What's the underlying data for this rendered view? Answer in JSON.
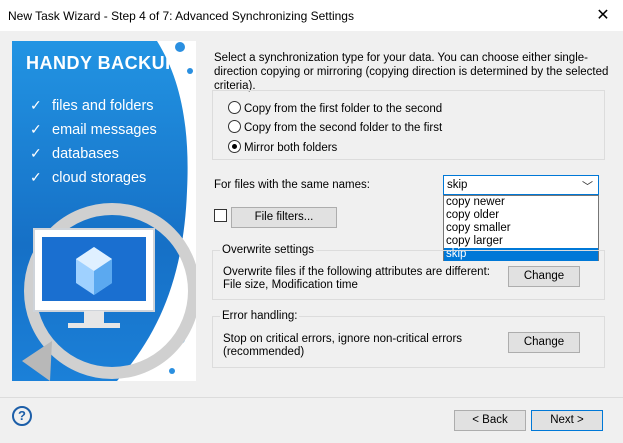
{
  "window": {
    "title": "New Task Wizard - Step 4 of 7: Advanced Synchronizing Settings",
    "close_glyph": "✕"
  },
  "banner": {
    "brand": "HANDY BACKUP",
    "check_glyph": "✓",
    "features": [
      "files and folders",
      "email messages",
      "databases",
      "cloud storages"
    ],
    "colors": {
      "primary": "#1f8fe0",
      "dark": "#1672c8",
      "screen": "#1a6fd0"
    }
  },
  "description": "Select a synchronization type for your data. You can choose either single-direction copying or mirroring (copying direction is determined by the selected criteria).",
  "sync_options": {
    "items": [
      {
        "label": "Copy from the first folder to the second",
        "selected": false
      },
      {
        "label": "Copy from the second folder to the first",
        "selected": false
      },
      {
        "label": "Mirror both folders",
        "selected": true
      }
    ]
  },
  "same_names": {
    "label": "For files with the same names:",
    "value": "skip",
    "options": [
      "copy newer",
      "copy older",
      "copy smaller",
      "copy larger",
      "skip"
    ]
  },
  "file_filters": {
    "button": "File filters...",
    "checked": false
  },
  "overwrite": {
    "title": "Overwrite settings",
    "line1": "Overwrite files if the following attributes are different:",
    "line2": "File size, Modification time",
    "button": "Change"
  },
  "error_handling": {
    "title": "Error handling:",
    "line1": "Stop on critical errors, ignore non-critical errors",
    "line2": "(recommended)",
    "button": "Change"
  },
  "footer": {
    "help_glyph": "?",
    "back": "< Back",
    "next": "Next >"
  }
}
